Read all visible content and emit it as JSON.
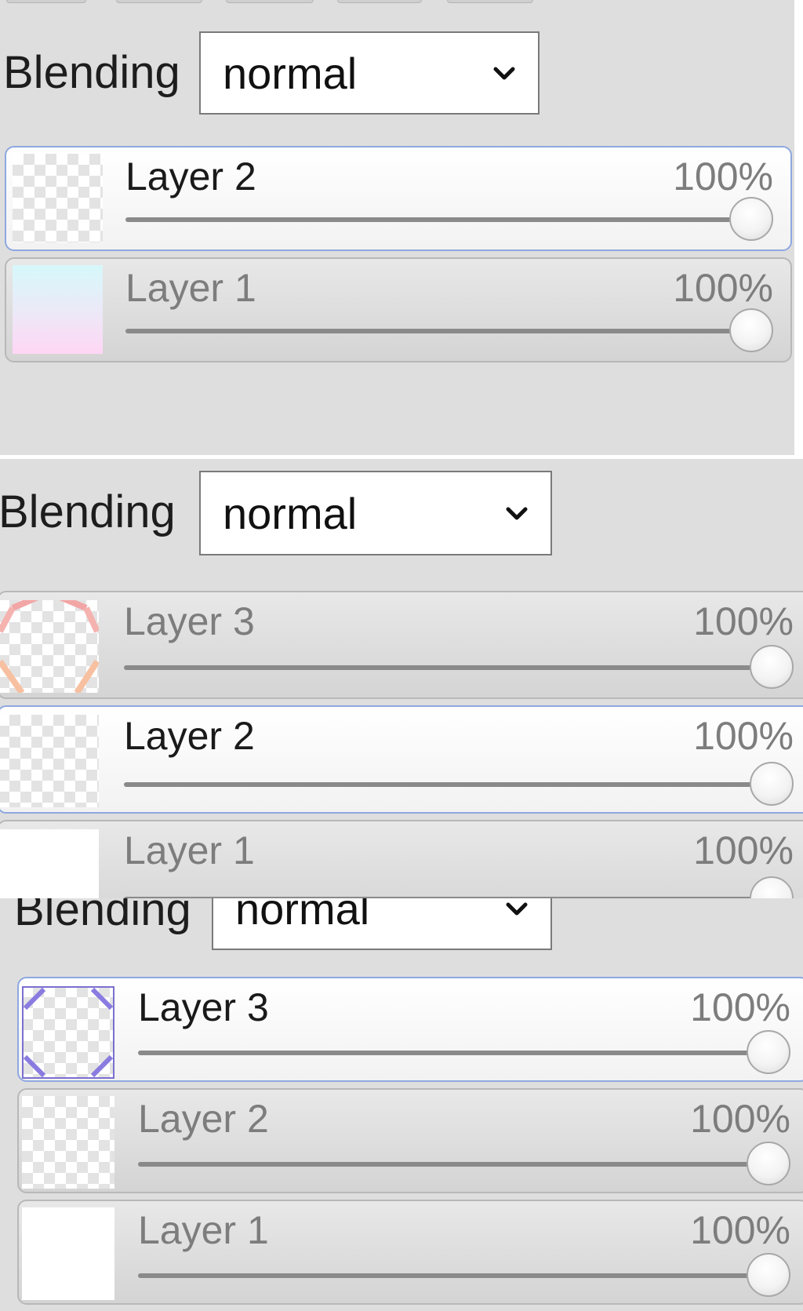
{
  "panels": [
    {
      "blending_label": "Blending",
      "blending_value": "normal",
      "layers": [
        {
          "name": "Layer 2",
          "opacity": "100%",
          "opacity_value": 100
        },
        {
          "name": "Layer 1",
          "opacity": "100%",
          "opacity_value": 100
        }
      ]
    },
    {
      "blending_label": "Blending",
      "blending_value": "normal",
      "layers": [
        {
          "name": "Layer 3",
          "opacity": "100%",
          "opacity_value": 100
        },
        {
          "name": "Layer 2",
          "opacity": "100%",
          "opacity_value": 100
        },
        {
          "name": "Layer 1",
          "opacity": "100%",
          "opacity_value": 100
        }
      ]
    },
    {
      "blending_label": "Blending",
      "blending_value": "normal",
      "layers": [
        {
          "name": "Layer 3",
          "opacity": "100%",
          "opacity_value": 100
        },
        {
          "name": "Layer 2",
          "opacity": "100%",
          "opacity_value": 100
        },
        {
          "name": "Layer 1",
          "opacity": "100%",
          "opacity_value": 100
        }
      ]
    }
  ]
}
